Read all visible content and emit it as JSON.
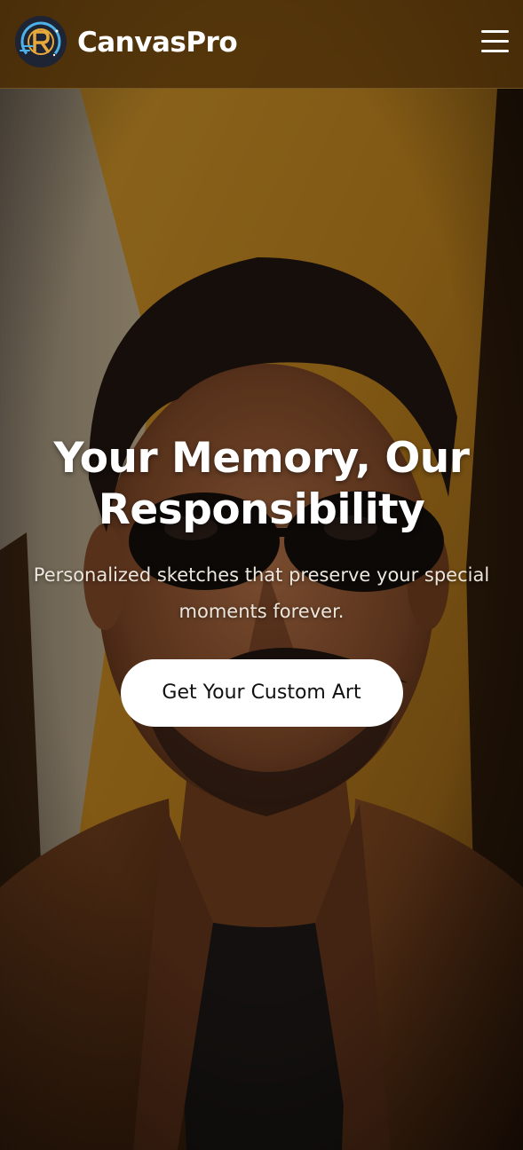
{
  "header": {
    "brand_name": "CanvasPro",
    "logo_icon": "canvaspro-logo-icon",
    "menu_icon": "hamburger-menu-icon"
  },
  "hero": {
    "title": "Your Memory, Our Responsibility",
    "subtitle": "Personalized sketches that preserve your special moments forever.",
    "cta_label": "Get Your Custom Art",
    "background_image": "painted-portrait-man-with-sunglasses"
  },
  "colors": {
    "header_bg": "#462a08",
    "cta_bg": "#ffffff",
    "cta_text": "#111111",
    "title_text": "#ffffff"
  }
}
